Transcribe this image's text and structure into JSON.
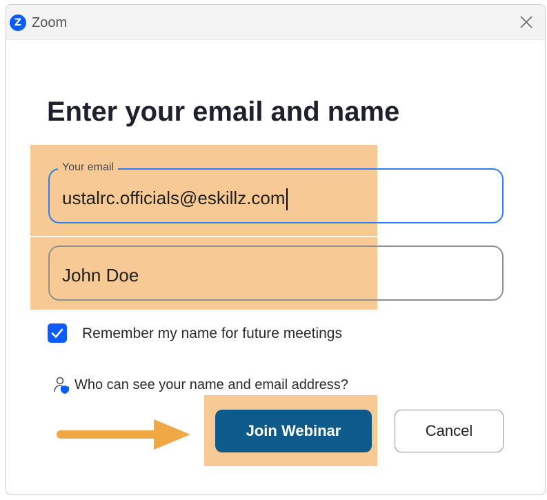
{
  "window": {
    "title": "Zoom",
    "logo_letter": "Z",
    "close_icon": "close-icon"
  },
  "dialog": {
    "heading": "Enter your email and name",
    "email": {
      "label": "Your email",
      "value": "ustalrc.officials@eskillz.com"
    },
    "name": {
      "value": "John Doe"
    },
    "remember": {
      "label": "Remember my name for future meetings",
      "checked": true
    },
    "privacy": {
      "icon": "person-shield-icon",
      "label": "Who can see your name and email address?"
    },
    "buttons": {
      "join": "Join Webinar",
      "cancel": "Cancel"
    }
  },
  "annotations": {
    "highlight_color": "#f6c995",
    "arrow_color": "#f0a845",
    "arrow_icon": "right-arrow-icon"
  },
  "colors": {
    "brand": "#0b5cff",
    "join_button": "#0e5a8a",
    "focus_border": "#2d7ff9"
  }
}
